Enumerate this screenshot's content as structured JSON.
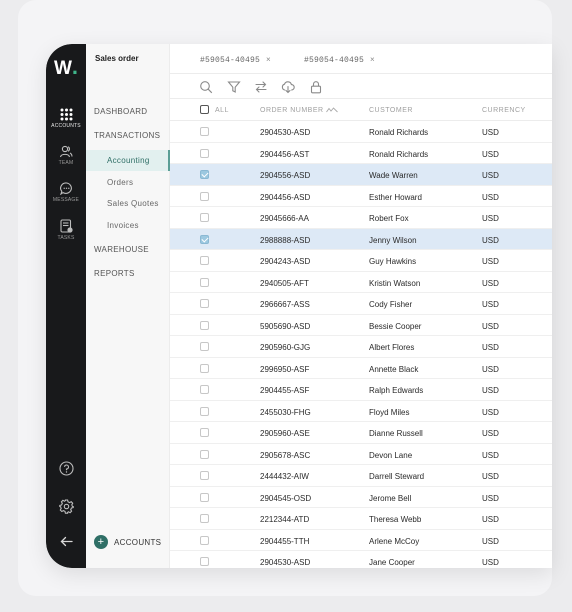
{
  "app": {
    "logo": "W",
    "title": "Sales order"
  },
  "rail": {
    "items": [
      {
        "name": "accounts",
        "label": "ACCOUNTS",
        "icon": "grid-icon"
      },
      {
        "name": "team",
        "label": "TEAM",
        "icon": "team-icon"
      },
      {
        "name": "message",
        "label": "MESSAGE",
        "icon": "message-icon"
      },
      {
        "name": "tasks",
        "label": "TASKS",
        "icon": "tasks-icon"
      }
    ],
    "bottom": [
      "help-icon",
      "settings-icon",
      "back-arrow-icon"
    ]
  },
  "sidebar": {
    "items": [
      {
        "label": "DASHBOARD",
        "type": "section"
      },
      {
        "label": "TRANSACTIONS",
        "type": "section"
      },
      {
        "label": "Accounting",
        "type": "sub",
        "active": true
      },
      {
        "label": "Orders",
        "type": "sub"
      },
      {
        "label": "Sales Quotes",
        "type": "sub"
      },
      {
        "label": "Invoices",
        "type": "sub"
      },
      {
        "label": "WAREHOUSE",
        "type": "section"
      },
      {
        "label": "REPORTS",
        "type": "section"
      }
    ],
    "accounts_button": "ACCOUNTS"
  },
  "tabs": [
    {
      "label": "#59054-40495",
      "close": "×"
    },
    {
      "label": "#59054-40495",
      "close": "×"
    }
  ],
  "toolbar": [
    "search-icon",
    "filter-icon",
    "swap-icon",
    "cloud-download-icon",
    "lock-icon"
  ],
  "table": {
    "headers": {
      "all": "ALL",
      "order_number": "ORDER NUMBER",
      "customer": "CUSTOMER",
      "currency": "CURRENCY"
    },
    "rows": [
      {
        "order": "2904530-ASD",
        "customer": "Ronald Richards",
        "currency": "USD",
        "checked": false
      },
      {
        "order": "2904456-AST",
        "customer": "Ronald Richards",
        "currency": "USD",
        "checked": false
      },
      {
        "order": "2904556-ASD",
        "customer": "Wade Warren",
        "currency": "USD",
        "checked": true
      },
      {
        "order": "2904456-ASD",
        "customer": "Esther Howard",
        "currency": "USD",
        "checked": false
      },
      {
        "order": "29045666-AA",
        "customer": "Robert Fox",
        "currency": "USD",
        "checked": false
      },
      {
        "order": "2988888-ASD",
        "customer": "Jenny Wilson",
        "currency": "USD",
        "checked": true
      },
      {
        "order": "2904243-ASD",
        "customer": "Guy Hawkins",
        "currency": "USD",
        "checked": false
      },
      {
        "order": "2940505-AFT",
        "customer": "Kristin Watson",
        "currency": "USD",
        "checked": false
      },
      {
        "order": "2966667-ASS",
        "customer": "Cody Fisher",
        "currency": "USD",
        "checked": false
      },
      {
        "order": "5905690-ASD",
        "customer": "Bessie Cooper",
        "currency": "USD",
        "checked": false
      },
      {
        "order": "2905960-GJG",
        "customer": "Albert Flores",
        "currency": "USD",
        "checked": false
      },
      {
        "order": "2996950-ASF",
        "customer": "Annette Black",
        "currency": "USD",
        "checked": false
      },
      {
        "order": "2904455-ASF",
        "customer": "Ralph Edwards",
        "currency": "USD",
        "checked": false
      },
      {
        "order": "2455030-FHG",
        "customer": "Floyd Miles",
        "currency": "USD",
        "checked": false
      },
      {
        "order": "2905960-ASE",
        "customer": "Dianne Russell",
        "currency": "USD",
        "checked": false
      },
      {
        "order": "2905678-ASC",
        "customer": "Devon Lane",
        "currency": "USD",
        "checked": false
      },
      {
        "order": "2444432-AIW",
        "customer": "Darrell Steward",
        "currency": "USD",
        "checked": false
      },
      {
        "order": "2904545-OSD",
        "customer": "Jerome Bell",
        "currency": "USD",
        "checked": false
      },
      {
        "order": "2212344-ATD",
        "customer": "Theresa Webb",
        "currency": "USD",
        "checked": false
      },
      {
        "order": "2904455-TTH",
        "customer": "Arlene McCoy",
        "currency": "USD",
        "checked": false
      },
      {
        "order": "2904530-ASD",
        "customer": "Jane Cooper",
        "currency": "USD",
        "checked": false
      }
    ]
  },
  "colors": {
    "rail": "#18191b",
    "accent": "#2f6f66",
    "selected_row": "#dde9f6",
    "checked_box": "#9cc8e0"
  }
}
